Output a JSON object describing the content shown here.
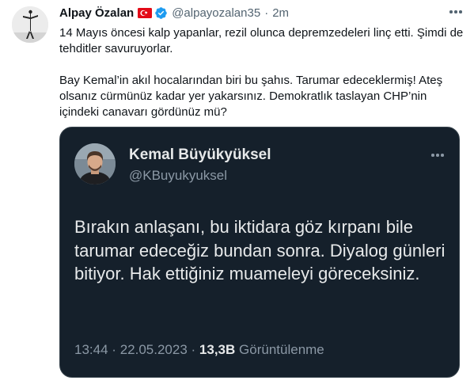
{
  "tweet": {
    "display_name": "Alpay Özalan",
    "handle": "@alpayozalan35",
    "separator": "·",
    "time": "2m",
    "paragraph_1": "14 Mayıs öncesi kalp yapanlar, rezil olunca depremzedeleri linç etti. Şimdi de tehditler savuruyorlar.",
    "paragraph_2": "Bay Kemal’in akıl hocalarından biri bu şahıs. Tarumar edeceklermiş! Ateş olsanız cürmünüz kadar yer yakarsınız. Demokratlık taslayan CHP’nin içindeki canavarı gördünüz mü?",
    "icons": {
      "flag": "turkey-flag-icon",
      "verified": "verified-badge-icon",
      "more": "more-options-icon"
    }
  },
  "quoted": {
    "display_name": "Kemal Büyükyüksel",
    "handle": "@KBuyukyuksel",
    "text": "Bırakın anlaşanı, bu iktidara göz kırpanı bile tarumar edeceğiz bundan sonra. Diyalog günleri bitiyor. Hak ettiğiniz muameleyi göreceksiniz.",
    "time": "13:44",
    "separator": "·",
    "date": "22.05.2023",
    "views_count": "13,3B",
    "views_label": "Görüntülenme"
  },
  "colors": {
    "accent_verified": "#1d9bf0",
    "flag_red": "#e30a17",
    "card_background": "#15202b",
    "text_primary": "#0f1419",
    "text_secondary": "#536471"
  }
}
